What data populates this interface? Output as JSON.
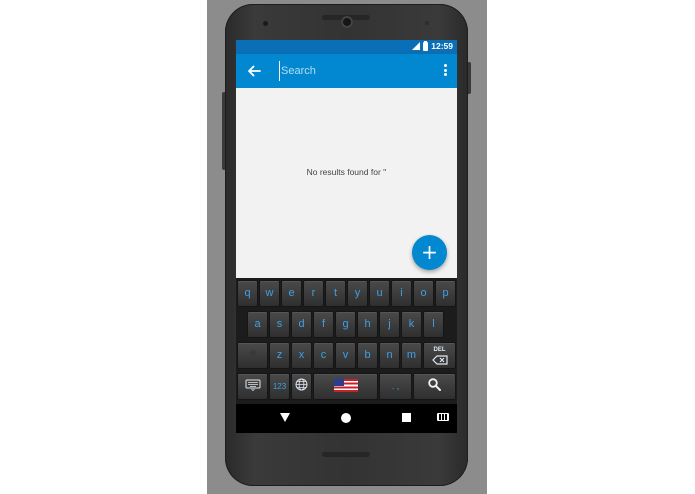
{
  "status_bar": {
    "time": "12:59",
    "icons": [
      "signal-icon",
      "battery-icon"
    ]
  },
  "toolbar": {
    "back_icon": "arrow-left-icon",
    "search_placeholder": "Search",
    "search_value": "",
    "more_icon": "more-vertical-icon"
  },
  "results": {
    "empty_message": "No results found for ''"
  },
  "fab": {
    "label": "+"
  },
  "keyboard": {
    "row1": [
      "q",
      "w",
      "e",
      "r",
      "t",
      "y",
      "u",
      "i",
      "o",
      "p"
    ],
    "row2": [
      "a",
      "s",
      "d",
      "f",
      "g",
      "h",
      "j",
      "k",
      "l"
    ],
    "row3": [
      "z",
      "x",
      "c",
      "v",
      "b",
      "n",
      "m"
    ],
    "shift_icon": "shift-arrow-icon",
    "delete_label": "DEL",
    "delete_icon": "backspace-icon",
    "keyboard_switch_icon": "keyboard-icon",
    "numbers_label": "123",
    "globe_icon": "globe-icon",
    "language_icon": "us-flag-icon",
    "punctuation_label": ". ,",
    "search_icon": "search-icon"
  },
  "nav_bar": {
    "back_icon": "nav-back-icon",
    "home_icon": "nav-home-icon",
    "recents_icon": "nav-recents-icon",
    "ime_icon": "keyboard-icon"
  },
  "colors": {
    "primary": "#0288d1",
    "status_bar": "#0a6fb7",
    "key_text": "#3ea0e4",
    "background": "#f2f2f2"
  }
}
